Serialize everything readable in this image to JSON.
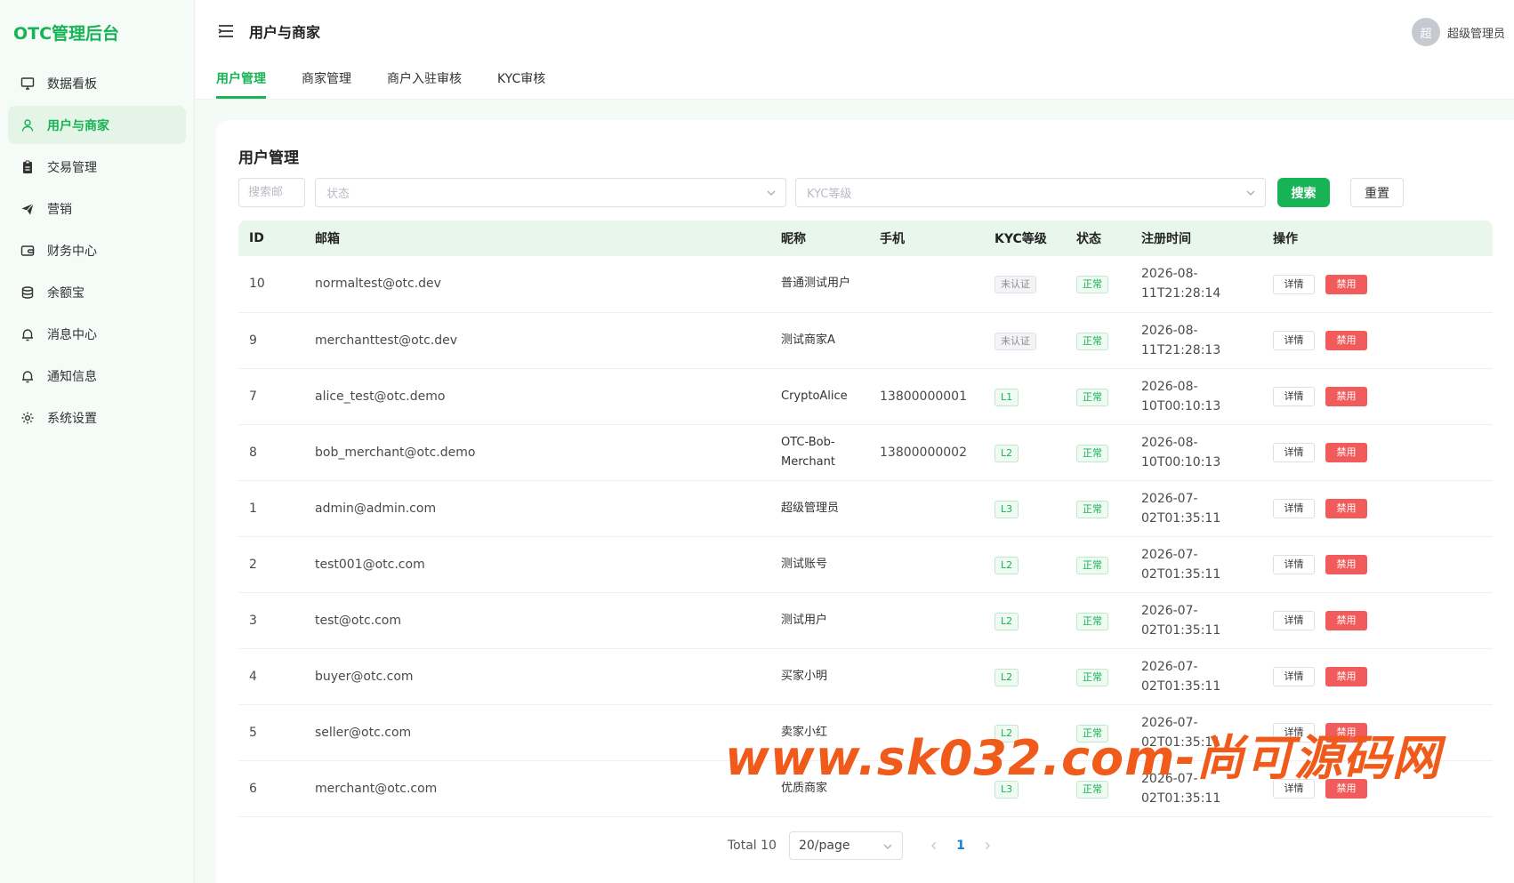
{
  "brand": "OTC管理后台",
  "header": {
    "title": "用户与商家",
    "user_avatar": "超",
    "user_name": "超级管理员"
  },
  "sidebar": {
    "items": [
      {
        "label": "数据看板",
        "icon": "monitor-icon"
      },
      {
        "label": "用户与商家",
        "icon": "user-icon"
      },
      {
        "label": "交易管理",
        "icon": "clipboard-icon"
      },
      {
        "label": "营销",
        "icon": "send-icon"
      },
      {
        "label": "财务中心",
        "icon": "wallet-icon"
      },
      {
        "label": "余额宝",
        "icon": "coins-icon"
      },
      {
        "label": "消息中心",
        "icon": "bell-icon"
      },
      {
        "label": "通知信息",
        "icon": "bell-icon"
      },
      {
        "label": "系统设置",
        "icon": "gear-icon"
      }
    ]
  },
  "tabs": [
    {
      "label": "用户管理",
      "active": true
    },
    {
      "label": "商家管理",
      "active": false
    },
    {
      "label": "商户入驻审核",
      "active": false
    },
    {
      "label": "KYC审核",
      "active": false
    }
  ],
  "card": {
    "title": "用户管理"
  },
  "filters": {
    "search_placeholder": "搜索邮",
    "status_placeholder": "状态",
    "kyc_placeholder": "KYC等级",
    "search_label": "搜索",
    "reset_label": "重置"
  },
  "table": {
    "columns": [
      "ID",
      "邮箱",
      "昵称",
      "手机",
      "KYC等级",
      "状态",
      "注册时间",
      "操作"
    ],
    "detail_label": "详情",
    "ban_label": "禁用",
    "rows": [
      {
        "id": "10",
        "email": "normaltest@otc.dev",
        "nickname": "普通测试用户",
        "phone": "",
        "kyc": "未认证",
        "status": "正常",
        "reg1": "2026-08-",
        "reg2": "11T21:28:14"
      },
      {
        "id": "9",
        "email": "merchanttest@otc.dev",
        "nickname": "测试商家A",
        "phone": "",
        "kyc": "未认证",
        "status": "正常",
        "reg1": "2026-08-",
        "reg2": "11T21:28:13"
      },
      {
        "id": "7",
        "email": "alice_test@otc.demo",
        "nickname": "CryptoAlice",
        "phone": "13800000001",
        "kyc": "L1",
        "status": "正常",
        "reg1": "2026-08-",
        "reg2": "10T00:10:13"
      },
      {
        "id": "8",
        "email": "bob_merchant@otc.demo",
        "nickname": "OTC-Bob-Merchant",
        "phone": "13800000002",
        "kyc": "L2",
        "status": "正常",
        "reg1": "2026-08-",
        "reg2": "10T00:10:13"
      },
      {
        "id": "1",
        "email": "admin@admin.com",
        "nickname": "超级管理员",
        "phone": "",
        "kyc": "L3",
        "status": "正常",
        "reg1": "2026-07-",
        "reg2": "02T01:35:11"
      },
      {
        "id": "2",
        "email": "test001@otc.com",
        "nickname": "测试账号",
        "phone": "",
        "kyc": "L2",
        "status": "正常",
        "reg1": "2026-07-",
        "reg2": "02T01:35:11"
      },
      {
        "id": "3",
        "email": "test@otc.com",
        "nickname": "测试用户",
        "phone": "",
        "kyc": "L2",
        "status": "正常",
        "reg1": "2026-07-",
        "reg2": "02T01:35:11"
      },
      {
        "id": "4",
        "email": "buyer@otc.com",
        "nickname": "买家小明",
        "phone": "",
        "kyc": "L2",
        "status": "正常",
        "reg1": "2026-07-",
        "reg2": "02T01:35:11"
      },
      {
        "id": "5",
        "email": "seller@otc.com",
        "nickname": "卖家小红",
        "phone": "",
        "kyc": "L2",
        "status": "正常",
        "reg1": "2026-07-",
        "reg2": "02T01:35:11"
      },
      {
        "id": "6",
        "email": "merchant@otc.com",
        "nickname": "优质商家",
        "phone": "",
        "kyc": "L3",
        "status": "正常",
        "reg1": "2026-07-",
        "reg2": "02T01:35:11"
      }
    ]
  },
  "pagination": {
    "total": "Total 10",
    "page_size": "20/page",
    "current_page": "1"
  },
  "watermark": "www.sk032.com-尚可源码网",
  "colors": {
    "accent": "#17b355",
    "danger": "#f25b5b",
    "watermark": "#f05a1a"
  }
}
